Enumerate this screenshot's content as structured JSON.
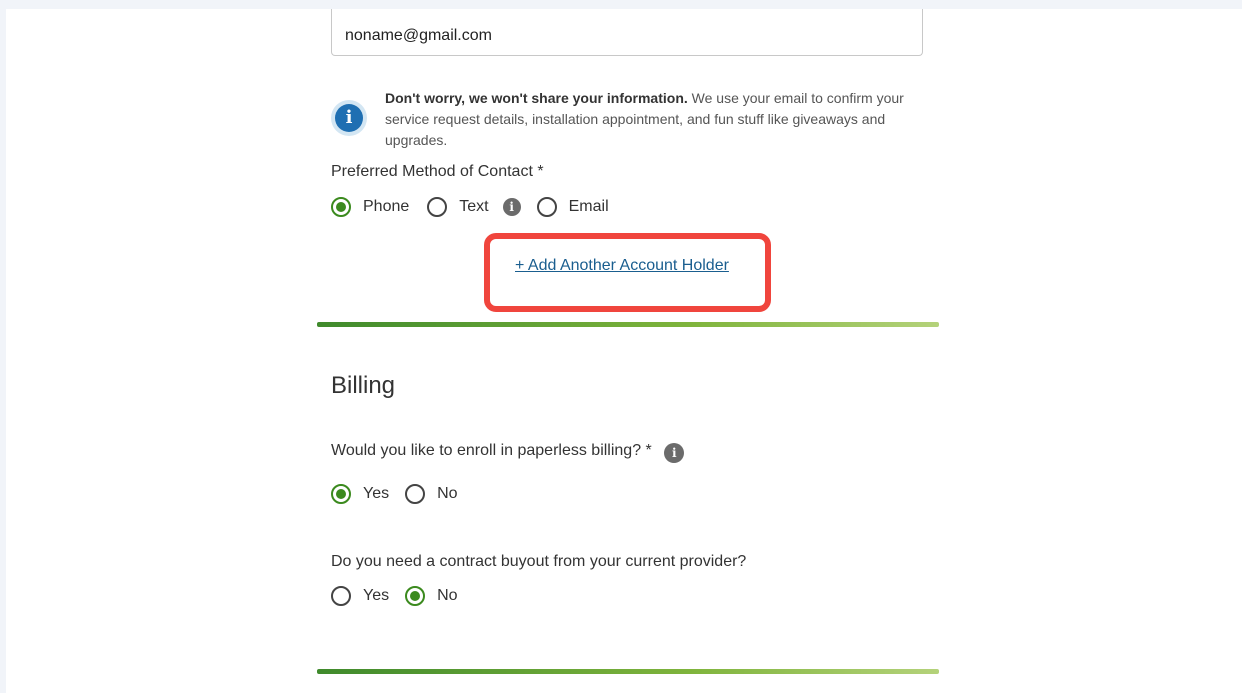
{
  "contact": {
    "email_value": "noname@gmail.com",
    "info_bold": "Don't worry, we won't share your information.",
    "info_rest": " We use your email to confirm your service request details, installation appointment, and fun stuff like giveaways and upgrades.",
    "preferred_label": "Preferred Method of Contact *",
    "options": [
      "Phone",
      "Text",
      "Email"
    ],
    "selected": "Phone",
    "add_holder": "+ Add Another Account Holder"
  },
  "billing": {
    "title": "Billing",
    "paperless_question": "Would you like to enroll in paperless billing? *",
    "paperless_options": [
      "Yes",
      "No"
    ],
    "paperless_selected": "Yes",
    "buyout_question": "Do you need a contract buyout from your current provider?",
    "buyout_options": [
      "Yes",
      "No"
    ],
    "buyout_selected": "No"
  },
  "colors": {
    "accent_green": "#3b8a1e",
    "link_blue": "#1a5e8f",
    "highlight_red": "#f0453d",
    "info_blue": "#1f6fb2"
  },
  "icons": {
    "info": "info-icon",
    "tooltip": "info-circle-icon"
  }
}
